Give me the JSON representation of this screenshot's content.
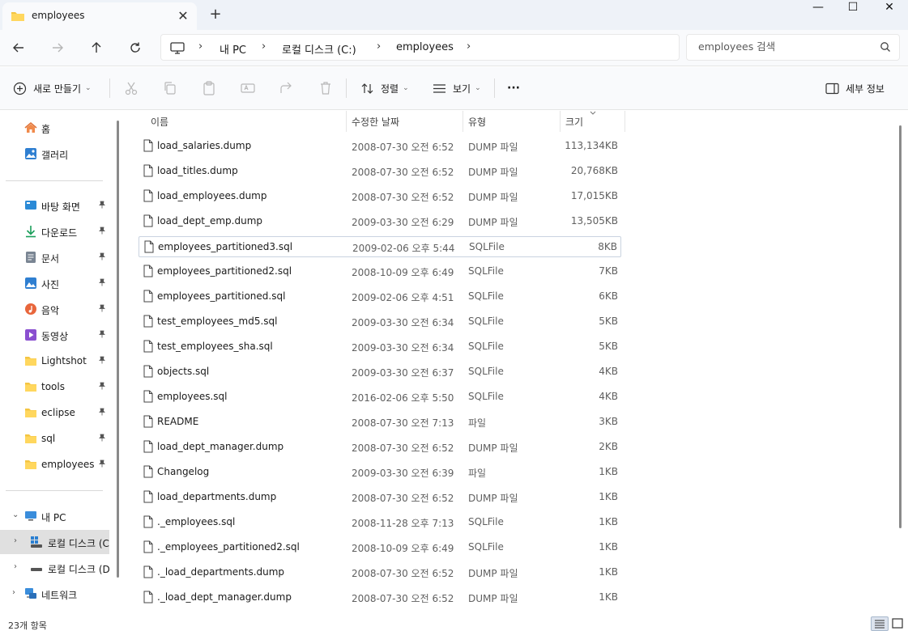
{
  "window": {
    "tab_title": "employees",
    "tab_close": "✕",
    "new_tab": "+",
    "minimize": "—",
    "maximize": "☐",
    "close": "✕"
  },
  "address": {
    "breadcrumbs": [
      "내 PC",
      "로컬 디스크 (C:)",
      "employees"
    ],
    "separator": "›",
    "search_placeholder": "employees 검색"
  },
  "toolbar": {
    "new_label": "새로 만들기",
    "sort_label": "정렬",
    "view_label": "보기",
    "more_label": "···",
    "details_label": "세부 정보",
    "chevron": "⌄"
  },
  "sidebar": {
    "quick": [
      {
        "label": "홈",
        "icon": "home-icon"
      },
      {
        "label": "갤러리",
        "icon": "gallery-icon"
      }
    ],
    "pinned": [
      {
        "label": "바탕 화면",
        "icon": "desktop-icon"
      },
      {
        "label": "다운로드",
        "icon": "download-icon"
      },
      {
        "label": "문서",
        "icon": "documents-icon"
      },
      {
        "label": "사진",
        "icon": "pictures-icon"
      },
      {
        "label": "음악",
        "icon": "music-icon"
      },
      {
        "label": "동영상",
        "icon": "videos-icon"
      },
      {
        "label": "Lightshot",
        "icon": "folder-icon"
      },
      {
        "label": "tools",
        "icon": "folder-icon"
      },
      {
        "label": "eclipse",
        "icon": "folder-icon"
      },
      {
        "label": "sql",
        "icon": "folder-icon"
      },
      {
        "label": "employees",
        "icon": "folder-icon"
      }
    ],
    "pin_glyph": "📌",
    "tree": [
      {
        "label": "내 PC",
        "expander": "⌄"
      },
      {
        "label": "로컬 디스크 (C:)",
        "expander": "›"
      },
      {
        "label": "로컬 디스크 (D:)",
        "expander": "›"
      },
      {
        "label": "네트워크",
        "expander": "›"
      }
    ]
  },
  "columns": {
    "name": "이름",
    "date": "수정한 날짜",
    "type": "유형",
    "size": "크기"
  },
  "files": [
    {
      "name": "load_salaries.dump",
      "date": "2008-07-30 오전 6:52",
      "type": "DUMP 파일",
      "size": "113,134KB"
    },
    {
      "name": "load_titles.dump",
      "date": "2008-07-30 오전 6:52",
      "type": "DUMP 파일",
      "size": "20,768KB"
    },
    {
      "name": "load_employees.dump",
      "date": "2008-07-30 오전 6:52",
      "type": "DUMP 파일",
      "size": "17,015KB"
    },
    {
      "name": "load_dept_emp.dump",
      "date": "2009-03-30 오전 6:29",
      "type": "DUMP 파일",
      "size": "13,505KB"
    },
    {
      "name": "employees_partitioned3.sql",
      "date": "2009-02-06 오후 5:44",
      "type": "SQLFile",
      "size": "8KB"
    },
    {
      "name": "employees_partitioned2.sql",
      "date": "2008-10-09 오후 6:49",
      "type": "SQLFile",
      "size": "7KB"
    },
    {
      "name": "employees_partitioned.sql",
      "date": "2009-02-06 오후 4:51",
      "type": "SQLFile",
      "size": "6KB"
    },
    {
      "name": "test_employees_md5.sql",
      "date": "2009-03-30 오전 6:34",
      "type": "SQLFile",
      "size": "5KB"
    },
    {
      "name": "test_employees_sha.sql",
      "date": "2009-03-30 오전 6:34",
      "type": "SQLFile",
      "size": "5KB"
    },
    {
      "name": "objects.sql",
      "date": "2009-03-30 오전 6:37",
      "type": "SQLFile",
      "size": "4KB"
    },
    {
      "name": "employees.sql",
      "date": "2016-02-06 오후 5:50",
      "type": "SQLFile",
      "size": "4KB"
    },
    {
      "name": "README",
      "date": "2008-07-30 오전 7:13",
      "type": "파일",
      "size": "3KB"
    },
    {
      "name": "load_dept_manager.dump",
      "date": "2008-07-30 오전 6:52",
      "type": "DUMP 파일",
      "size": "2KB"
    },
    {
      "name": "Changelog",
      "date": "2009-03-30 오전 6:39",
      "type": "파일",
      "size": "1KB"
    },
    {
      "name": "load_departments.dump",
      "date": "2008-07-30 오전 6:52",
      "type": "DUMP 파일",
      "size": "1KB"
    },
    {
      "name": "._employees.sql",
      "date": "2008-11-28 오후 7:13",
      "type": "SQLFile",
      "size": "1KB"
    },
    {
      "name": "._employees_partitioned2.sql",
      "date": "2008-10-09 오후 6:49",
      "type": "SQLFile",
      "size": "1KB"
    },
    {
      "name": "._load_departments.dump",
      "date": "2008-07-30 오전 6:52",
      "type": "DUMP 파일",
      "size": "1KB"
    },
    {
      "name": "._load_dept_manager.dump",
      "date": "2008-07-30 오전 6:52",
      "type": "DUMP 파일",
      "size": "1KB"
    }
  ],
  "status": {
    "item_count": "23개 항목"
  }
}
